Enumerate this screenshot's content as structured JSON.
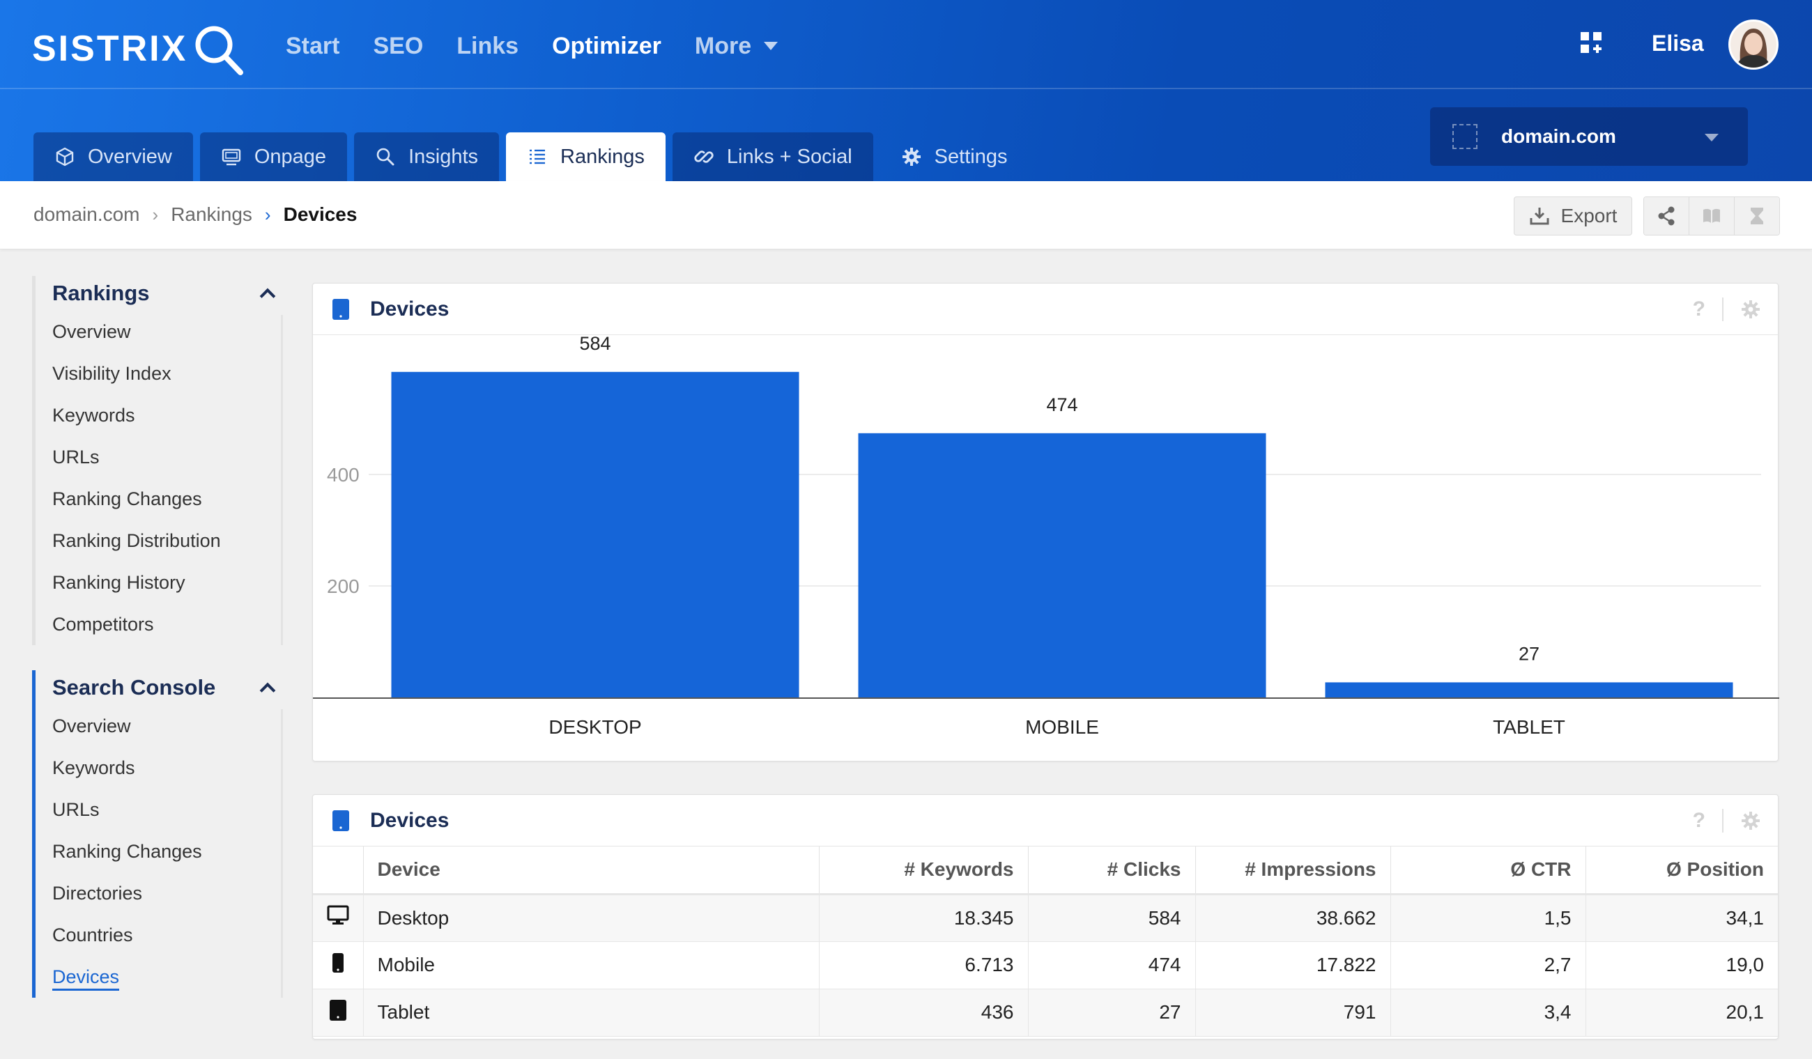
{
  "header": {
    "logo": "SISTRIX",
    "nav": [
      {
        "label": "Start",
        "active": false
      },
      {
        "label": "SEO",
        "active": false
      },
      {
        "label": "Links",
        "active": false
      },
      {
        "label": "Optimizer",
        "active": true
      },
      {
        "label": "More",
        "active": false
      }
    ],
    "user_name": "Elisa"
  },
  "tabs": [
    {
      "label": "Overview",
      "icon": "cube-icon"
    },
    {
      "label": "Onpage",
      "icon": "monitor-icon"
    },
    {
      "label": "Insights",
      "icon": "search-icon"
    },
    {
      "label": "Rankings",
      "icon": "list-icon"
    },
    {
      "label": "Links + Social",
      "icon": "link-icon"
    },
    {
      "label": "Settings",
      "icon": "gear-icon"
    }
  ],
  "domain_select": {
    "value": "domain.com"
  },
  "breadcrumb": {
    "items": [
      "domain.com",
      "Rankings",
      "Devices"
    ]
  },
  "toolbar": {
    "export_label": "Export"
  },
  "sidebar": {
    "sections": [
      {
        "title": "Rankings",
        "items": [
          "Overview",
          "Visibility Index",
          "Keywords",
          "URLs",
          "Ranking Changes",
          "Ranking Distribution",
          "Ranking History",
          "Competitors"
        ]
      },
      {
        "title": "Search Console",
        "items": [
          "Overview",
          "Keywords",
          "URLs",
          "Ranking Changes",
          "Directories",
          "Countries",
          "Devices"
        ],
        "active_item": "Devices"
      }
    ]
  },
  "chart_card": {
    "title": "Devices",
    "help": "?"
  },
  "chart_data": {
    "type": "bar",
    "categories": [
      "DESKTOP",
      "MOBILE",
      "TABLET"
    ],
    "values": [
      584,
      474,
      27
    ],
    "data_labels": [
      "584",
      "474",
      "27"
    ],
    "y_ticks": [
      200,
      400
    ],
    "ylim": [
      0,
      650
    ],
    "grid": true,
    "bar_color": "#1565d8"
  },
  "table_card": {
    "title": "Devices",
    "help": "?",
    "columns": [
      "Device",
      "# Keywords",
      "# Clicks",
      "# Impressions",
      "Ø CTR",
      "Ø Position"
    ],
    "rows": [
      {
        "icon": "desktop-icon",
        "device": "Desktop",
        "keywords": "18.345",
        "clicks": "584",
        "impressions": "38.662",
        "ctr": "1,5",
        "position": "34,1"
      },
      {
        "icon": "mobile-icon",
        "device": "Mobile",
        "keywords": "6.713",
        "clicks": "474",
        "impressions": "17.822",
        "ctr": "2,7",
        "position": "19,0"
      },
      {
        "icon": "tablet-icon",
        "device": "Tablet",
        "keywords": "436",
        "clicks": "27",
        "impressions": "791",
        "ctr": "3,4",
        "position": "20,1"
      }
    ]
  },
  "colors": {
    "accent": "#1a66d2",
    "bar": "#1565d8",
    "heading": "#1b2d55"
  }
}
